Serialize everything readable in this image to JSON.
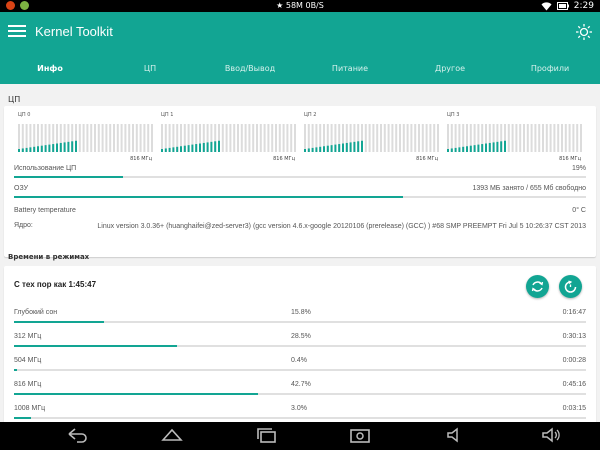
{
  "status_bar": {
    "network": "★ 58M  0B/S",
    "time": "2:29"
  },
  "toolbar": {
    "title": "Kernel Toolkit",
    "menu_icon": "hamburger-menu-icon",
    "brightness_icon": "sun-icon"
  },
  "tabs": [
    {
      "label": "Инфо",
      "active": true
    },
    {
      "label": "ЦП",
      "active": false
    },
    {
      "label": "Ввод/Вывод",
      "active": false
    },
    {
      "label": "Питание",
      "active": false
    },
    {
      "label": "Другое",
      "active": false
    },
    {
      "label": "Профили",
      "active": false
    }
  ],
  "cpu_section": {
    "title": "ЦП",
    "cpus": [
      {
        "name": "ЦП 0",
        "freq": "816 МГц"
      },
      {
        "name": "ЦП 1",
        "freq": "816 МГц"
      },
      {
        "name": "ЦП 2",
        "freq": "816 МГц"
      },
      {
        "name": "ЦП 3",
        "freq": "816 МГц"
      }
    ],
    "usage_label": "Использование ЦП",
    "usage_value": "19%",
    "usage_fraction": 0.19,
    "ram_label": "ОЗУ",
    "ram_value": "1393 МБ занято / 655 Мб свободно",
    "ram_fraction": 0.68,
    "battery_label": "Battery temperature",
    "battery_value": "0° C",
    "kernel_label": "Ядро:",
    "kernel_value": "Linux version 3.0.36+ (huanghaifei@zed-server3) (gcc version 4.6.x-google 20120106 (prerelease) (GCC) ) #68 SMP PREEMPT Fri Jul 5 10:26:37 CST 2013"
  },
  "states_section": {
    "title": "Времени в режимах",
    "since": "С тех пор как 1:45:47",
    "refresh_icon": "refresh-icon",
    "reset_icon": "reset-icon",
    "rows": [
      {
        "label": "Глубокий сон",
        "percent": "15.8%",
        "time": "0:16:47",
        "fraction": 0.158
      },
      {
        "label": "312 МГц",
        "percent": "28.5%",
        "time": "0:30:13",
        "fraction": 0.285
      },
      {
        "label": "504 МГц",
        "percent": "0.4%",
        "time": "0:00:28",
        "fraction": 0.004
      },
      {
        "label": "816 МГц",
        "percent": "42.7%",
        "time": "0:45:16",
        "fraction": 0.427
      },
      {
        "label": "1008 МГц",
        "percent": "3.0%",
        "time": "0:03:15",
        "fraction": 0.03
      }
    ]
  },
  "nav_bar": {
    "icons": [
      "back-icon",
      "home-icon",
      "recents-icon",
      "screenshot-icon",
      "volume-down-icon",
      "volume-up-icon"
    ]
  },
  "colors": {
    "accent": "#12a593",
    "background": "#f2f2f2"
  }
}
